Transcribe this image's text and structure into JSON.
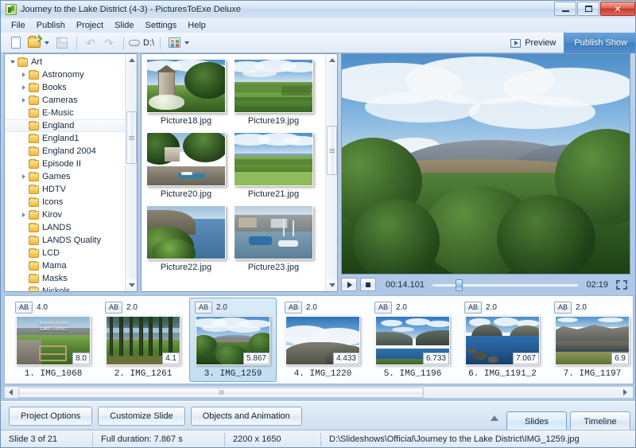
{
  "window": {
    "title": "Journey to the Lake District (4-3) - PicturesToExe Deluxe",
    "app_icon": "app-chart-icon",
    "minimize_label": "—",
    "maximize_label": "□",
    "close_label": "✕"
  },
  "menu": {
    "items": [
      "File",
      "Publish",
      "Project",
      "Slide",
      "Settings",
      "Help"
    ]
  },
  "toolbar": {
    "new_label": "New",
    "open_label": "Open",
    "save_label": "Save",
    "undo_label": "↶",
    "redo_label": "↷",
    "drive_label": "D:\\",
    "view_label": "View mode",
    "preview_label": "Preview",
    "publish_label": "Publish Show"
  },
  "tree": {
    "items": [
      {
        "label": "Art",
        "depth": 0,
        "expander": "open",
        "selected": false
      },
      {
        "label": "Astronomy",
        "depth": 1,
        "expander": "closed",
        "selected": false
      },
      {
        "label": "Books",
        "depth": 1,
        "expander": "closed",
        "selected": false
      },
      {
        "label": "Cameras",
        "depth": 1,
        "expander": "closed",
        "selected": false
      },
      {
        "label": "E-Music",
        "depth": 1,
        "expander": "none",
        "selected": false
      },
      {
        "label": "England",
        "depth": 1,
        "expander": "none",
        "selected": true
      },
      {
        "label": "England1",
        "depth": 1,
        "expander": "none",
        "selected": false
      },
      {
        "label": "England 2004",
        "depth": 1,
        "expander": "none",
        "selected": false
      },
      {
        "label": "Episode II",
        "depth": 1,
        "expander": "none",
        "selected": false
      },
      {
        "label": "Games",
        "depth": 1,
        "expander": "closed",
        "selected": false
      },
      {
        "label": "HDTV",
        "depth": 1,
        "expander": "none",
        "selected": false
      },
      {
        "label": "Icons",
        "depth": 1,
        "expander": "none",
        "selected": false
      },
      {
        "label": "Kirov",
        "depth": 1,
        "expander": "closed",
        "selected": false
      },
      {
        "label": "LANDS",
        "depth": 1,
        "expander": "none",
        "selected": false
      },
      {
        "label": "LANDS Quality",
        "depth": 1,
        "expander": "none",
        "selected": false
      },
      {
        "label": "LCD",
        "depth": 1,
        "expander": "none",
        "selected": false
      },
      {
        "label": "Mama",
        "depth": 1,
        "expander": "none",
        "selected": false
      },
      {
        "label": "Masks",
        "depth": 1,
        "expander": "none",
        "selected": false
      },
      {
        "label": "Nickols",
        "depth": 1,
        "expander": "none",
        "selected": false
      }
    ]
  },
  "files": {
    "items": [
      {
        "name": "Picture18.jpg",
        "scene": "tower"
      },
      {
        "name": "Picture19.jpg",
        "scene": "fields"
      },
      {
        "name": "Picture20.jpg",
        "scene": "estuary"
      },
      {
        "name": "Picture21.jpg",
        "scene": "coastfields"
      },
      {
        "name": "Picture22.jpg",
        "scene": "cliff"
      },
      {
        "name": "Picture23.jpg",
        "scene": "harbour"
      }
    ]
  },
  "preview": {
    "scene": "mountain-valley",
    "play_label": "Play",
    "stop_label": "Stop",
    "current_time": "00:14.101",
    "total_time": "02:19",
    "progress_percent": 16,
    "fullscreen_label": "Full screen"
  },
  "filmstrip": {
    "slides": [
      {
        "index": "1.",
        "name": "IMG_1068",
        "ab": "AB",
        "transition": "4.0",
        "duration": "8.0",
        "selected": false,
        "scene": "gate",
        "overlay_title": "Journey to the\nLake District"
      },
      {
        "index": "2.",
        "name": "IMG_1261",
        "ab": "AB",
        "transition": "2.0",
        "duration": "4.1",
        "selected": false,
        "scene": "woods",
        "overlay_title": ""
      },
      {
        "index": "3.",
        "name": "IMG_1259",
        "ab": "AB",
        "transition": "2.0",
        "duration": "5.867",
        "selected": true,
        "scene": "mountain-valley",
        "overlay_title": ""
      },
      {
        "index": "4.",
        "name": "IMG_1220",
        "ab": "AB",
        "transition": "2.0",
        "duration": "4.433",
        "selected": false,
        "scene": "cloudpeak",
        "overlay_title": ""
      },
      {
        "index": "5.",
        "name": "IMG_1196",
        "ab": "AB",
        "transition": "2.0",
        "duration": "6.733",
        "selected": false,
        "scene": "lake",
        "overlay_title": ""
      },
      {
        "index": "6.",
        "name": "IMG_1191_2",
        "ab": "AB",
        "transition": "2.0",
        "duration": "7.067",
        "selected": false,
        "scene": "lakerocks",
        "overlay_title": ""
      },
      {
        "index": "7.",
        "name": "IMG_1197",
        "ab": "AB",
        "transition": "2.0",
        "duration": "6.9",
        "selected": false,
        "scene": "scree",
        "overlay_title": ""
      }
    ]
  },
  "bottom": {
    "project_options_label": "Project Options",
    "customize_slide_label": "Customize Slide",
    "objects_animation_label": "Objects and Animation",
    "collapse_label": "△",
    "tabs": [
      {
        "label": "Slides",
        "active": true
      },
      {
        "label": "Timeline",
        "active": false
      }
    ]
  },
  "status": {
    "slide_counter": "Slide 3 of 21",
    "full_duration": "Full duration: 7.867 s",
    "dimensions": "2200 x 1650",
    "path": "D:\\Slideshows\\Official\\Journey to the Lake District\\IMG_1259.jpg"
  },
  "colors": {
    "accent": "#4f8dcb",
    "selection": "#c3ddf2",
    "frame": "#7e9cbb",
    "close_red": "#c63a2c"
  }
}
